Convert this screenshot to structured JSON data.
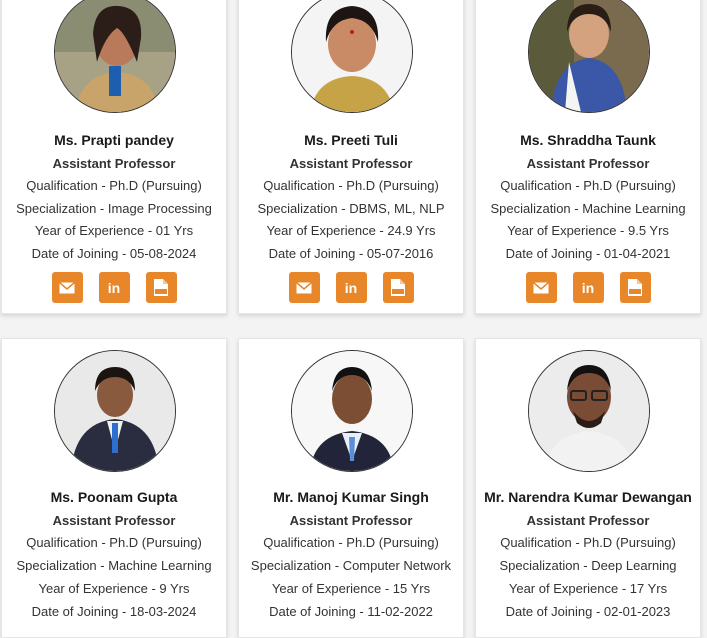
{
  "faculty": [
    {
      "name": "Ms. Prapti pandey",
      "designation": "Assistant Professor",
      "qualification": "Qualification - Ph.D (Pursuing)",
      "specialization": "Specialization - Image Processing",
      "experience": "Year of Experience - 01 Yrs",
      "joining": "Date of Joining - 05-08-2024"
    },
    {
      "name": "Ms. Preeti Tuli",
      "designation": "Assistant Professor",
      "qualification": "Qualification - Ph.D (Pursuing)",
      "specialization": "Specialization - DBMS, ML, NLP",
      "experience": "Year of Experience - 24.9 Yrs",
      "joining": "Date of Joining - 05-07-2016"
    },
    {
      "name": "Ms. Shraddha Taunk",
      "designation": "Assistant Professor",
      "qualification": "Qualification - Ph.D (Pursuing)",
      "specialization": "Specialization - Machine Learning",
      "experience": "Year of Experience - 9.5 Yrs",
      "joining": "Date of Joining - 01-04-2021"
    },
    {
      "name": "Ms. Poonam Gupta",
      "designation": "Assistant Professor",
      "qualification": "Qualification - Ph.D (Pursuing)",
      "specialization": "Specialization - Machine Learning",
      "experience": "Year of Experience - 9 Yrs",
      "joining": "Date of Joining - 18-03-2024"
    },
    {
      "name": "Mr. Manoj Kumar Singh",
      "designation": "Assistant Professor",
      "qualification": "Qualification - Ph.D (Pursuing)",
      "specialization": "Specialization - Computer Network",
      "experience": "Year of Experience - 15 Yrs",
      "joining": "Date of Joining - 11-02-2022"
    },
    {
      "name": "Mr. Narendra Kumar Dewangan",
      "designation": "Assistant Professor",
      "qualification": "Qualification - Ph.D (Pursuing)",
      "specialization": "Specialization - Deep Learning",
      "experience": "Year of Experience - 17 Yrs",
      "joining": "Date of Joining - 02-01-2023"
    }
  ],
  "social_icons": [
    "email-icon",
    "linkedin-icon",
    "pdf-icon"
  ],
  "colors": {
    "accent": "#e8862a",
    "card_bg": "#ffffff",
    "page_bg": "#f3f3f3"
  }
}
